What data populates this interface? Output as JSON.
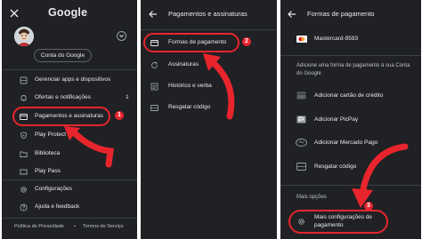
{
  "panel1": {
    "title": "Google",
    "account_button": "Conta do Google",
    "menu": [
      {
        "label": "Gerenciar apps e dispositivos",
        "icon": "apps-icon"
      },
      {
        "label": "Ofertas e notificações",
        "icon": "bell-icon",
        "count": "1"
      },
      {
        "label": "Pagamentos e assinaturas",
        "icon": "card-icon"
      },
      {
        "label": "Play Protect",
        "icon": "shield-icon"
      },
      {
        "label": "Biblioteca",
        "icon": "folder-icon"
      },
      {
        "label": "Play Pass",
        "icon": "ticket-icon"
      },
      {
        "label": "Configurações",
        "icon": "gear-icon"
      },
      {
        "label": "Ajuda e feedback",
        "icon": "help-icon"
      }
    ],
    "footer": {
      "privacy": "Política de Privacidade",
      "dot": "•",
      "terms": "Termos de Serviço"
    },
    "step": "1"
  },
  "panel2": {
    "title": "Pagamentos e assinaturas",
    "menu": [
      {
        "label": "Formas de pagamento",
        "icon": "card-icon"
      },
      {
        "label": "Assinaturas",
        "icon": "refresh-icon"
      },
      {
        "label": "Histórico e verba",
        "icon": "list-icon"
      },
      {
        "label": "Resgatar código",
        "icon": "redeem-card-icon"
      }
    ],
    "step": "2"
  },
  "panel3": {
    "title": "Formas de pagamento",
    "card": "Mastercard-9593",
    "add_text": "Adicione uma forma de pagamento à sua Conta do Google",
    "options": [
      {
        "label": "Adicionar cartão de crédito",
        "icon": "credit-card-icon"
      },
      {
        "label": "Adicionar PicPay",
        "icon": "picpay-icon"
      },
      {
        "label": "Adicionar Mercado Pago",
        "icon": "mercado-pago-icon"
      },
      {
        "label": "Resgatar código",
        "icon": "redeem-card-icon"
      }
    ],
    "more_options": "Mais opções",
    "more_settings": "Mais configurações de pagamento",
    "step": "3"
  },
  "colors": {
    "background": "#202124",
    "highlight": "#e8252d",
    "text": "#e8eaed",
    "secondary_text": "#bdc1c6"
  }
}
